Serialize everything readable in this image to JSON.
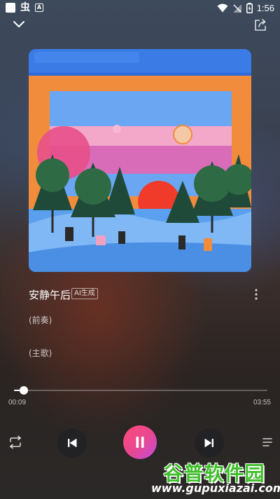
{
  "status_bar": {
    "bug_glyph": "虫",
    "a_glyph": "A",
    "time": "1:56"
  },
  "song": {
    "title": "安静午后",
    "badge": "AI生成"
  },
  "lyrics": [
    "(前奏)",
    "(主歌)"
  ],
  "playback": {
    "elapsed": "00:09",
    "total": "03:55",
    "progress_fraction": 0.038,
    "state": "playing"
  },
  "icons": {
    "collapse": "chevron-down-icon",
    "share": "share-icon",
    "more": "more-vertical-icon",
    "repeat": "repeat-icon",
    "previous": "skip-previous-icon",
    "pause": "pause-icon",
    "next": "skip-next-icon",
    "playlist": "playlist-icon"
  },
  "colors": {
    "play_button_start": "#ff4a78",
    "play_button_end": "#c44be0",
    "control_button_bg": "#222224"
  },
  "watermark": {
    "title": "谷普软件园",
    "url": "www.gupuxiazai.com"
  }
}
